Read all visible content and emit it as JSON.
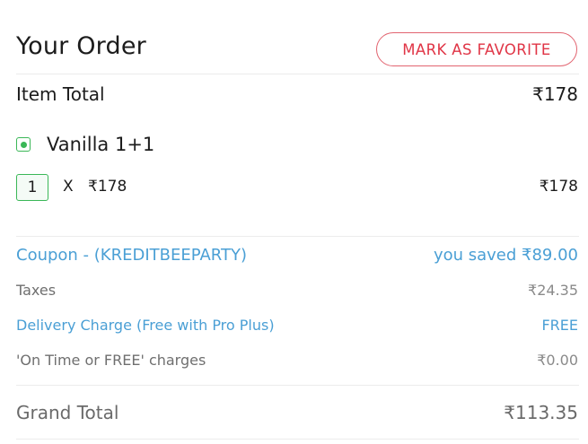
{
  "header": {
    "title": "Your Order",
    "favorite_button": "MARK AS FAVORITE"
  },
  "item_total": {
    "label": "Item Total",
    "value": "₹178"
  },
  "items": [
    {
      "name": "Vanilla 1+1",
      "veg": true,
      "quantity": "1",
      "multiplier": "X",
      "unit_price": "₹178",
      "line_price": "₹178"
    }
  ],
  "charges": {
    "coupon": {
      "label": "Coupon - (KREDITBEEPARTY)",
      "value": "you saved ₹89.00"
    },
    "taxes": {
      "label": "Taxes",
      "value": "₹24.35"
    },
    "delivery": {
      "label": "Delivery Charge (Free with Pro Plus)",
      "value": "FREE"
    },
    "on_time": {
      "label": "'On Time or FREE' charges",
      "value": "₹0.00"
    }
  },
  "grand_total": {
    "label": "Grand Total",
    "value": "₹113.35"
  },
  "colors": {
    "accent_red": "#e03546",
    "link_blue": "#4a9fd5",
    "veg_green": "#3ab757"
  }
}
